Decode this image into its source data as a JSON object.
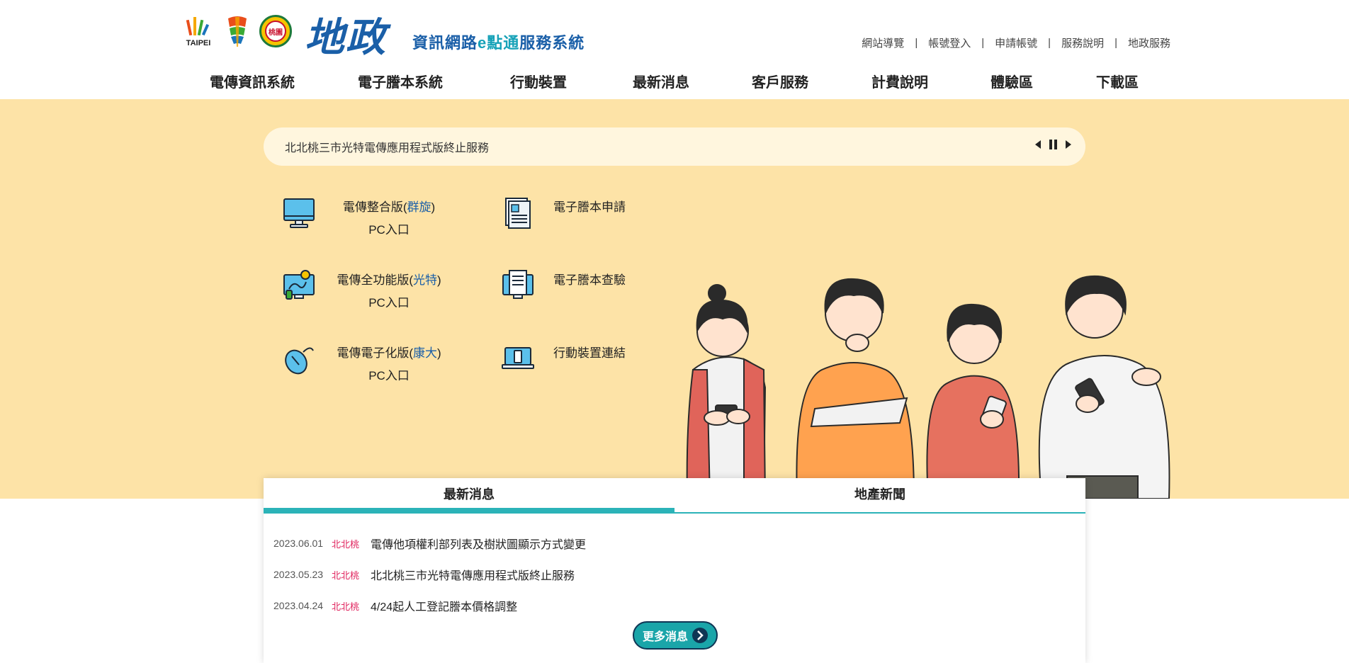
{
  "header": {
    "logos": {
      "taipei": "TAIPEI",
      "taoyuan": "桃園"
    },
    "brand_big": "地政",
    "brand_sub_a": "資訊網路",
    "brand_sub_e": "e",
    "brand_sub_b": "點通",
    "brand_sub_c": "服務系統",
    "top_links": [
      "網站導覽",
      "帳號登入",
      "申請帳號",
      "服務說明",
      "地政服務"
    ]
  },
  "nav": {
    "items": [
      "電傳資訊系統",
      "電子謄本系統",
      "行動裝置",
      "最新消息",
      "客戶服務",
      "計費說明",
      "體驗區",
      "下載區"
    ]
  },
  "ticker": {
    "text": "北北桃三市光特電傳應用程式版終止服務"
  },
  "services": {
    "left": [
      {
        "name": "電傳整合版(",
        "vendor": "群旋",
        "close": ")",
        "sub": "PC入口",
        "icon": "monitor-icon"
      },
      {
        "name": "電傳全功能版(",
        "vendor": "光特",
        "close": ")",
        "sub": "PC入口",
        "icon": "computer-idea-icon"
      },
      {
        "name": "電傳電子化版(",
        "vendor": "康大",
        "close": ")",
        "sub": "PC入口",
        "icon": "mouse-icon"
      }
    ],
    "right": [
      {
        "name": "電子謄本申請",
        "icon": "document-icon"
      },
      {
        "name": "電子謄本查驗",
        "icon": "document-verify-icon"
      },
      {
        "name": "行動裝置連結",
        "icon": "laptop-mobile-icon"
      }
    ]
  },
  "news": {
    "tabs": [
      "最新消息",
      "地產新聞"
    ],
    "items": [
      {
        "date": "2023.06.01",
        "tag": "北北桃",
        "title": "電傳他項權利部列表及樹狀圖顯示方式變更"
      },
      {
        "date": "2023.05.23",
        "tag": "北北桃",
        "title": "北北桃三市光特電傳應用程式版終止服務"
      },
      {
        "date": "2023.04.24",
        "tag": "北北桃",
        "title": "4/24起人工登記謄本價格調整"
      }
    ],
    "more_label": "更多消息"
  },
  "colors": {
    "hero_bg": "#fde3a7",
    "accent_teal": "#2bb3b8",
    "brand_blue": "#1a5fa8",
    "tag_pink": "#e0245e"
  }
}
